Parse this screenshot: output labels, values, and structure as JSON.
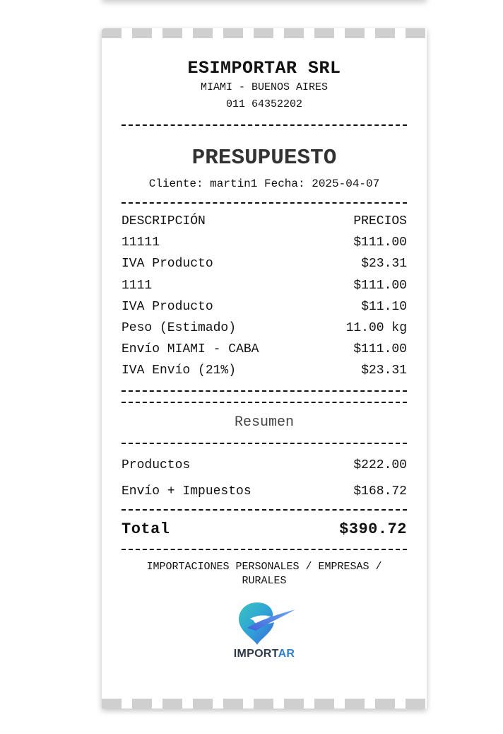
{
  "company": {
    "name": "ESIMPORTAR SRL",
    "location": "MIAMI - BUENOS AIRES",
    "phone": "011 64352202"
  },
  "document": {
    "title": "PRESUPUESTO",
    "client_label": "Cliente:",
    "client": "martin1",
    "date_label": "Fecha:",
    "date": "2025-04-07"
  },
  "table": {
    "headers": {
      "description": "DESCRIPCIÓN",
      "price": "PRECIOS"
    },
    "rows": [
      {
        "description": "11111",
        "price": "$111.00"
      },
      {
        "description": "IVA Producto",
        "price": "$23.31"
      },
      {
        "description": "1111",
        "price": "$111.00"
      },
      {
        "description": "IVA Producto",
        "price": "$11.10"
      },
      {
        "description": "Peso (Estimado)",
        "price": "11.00 kg"
      },
      {
        "description": "Envío MIAMI - CABA",
        "price": "$111.00"
      },
      {
        "description": "IVA Envío (21%)",
        "price": "$23.31"
      }
    ]
  },
  "summary": {
    "title": "Resumen",
    "rows": [
      {
        "label": "Productos",
        "value": "$222.00"
      },
      {
        "label": "Envío + Impuestos",
        "value": "$168.72"
      }
    ],
    "total_label": "Total",
    "total_value": "$390.72"
  },
  "footer": {
    "tagline": "IMPORTACIONES PERSONALES / EMPRESAS / RURALES",
    "logo_text_main": "IMPORT",
    "logo_text_accent": "AR",
    "logo_accent_color": "#2f7fcf"
  }
}
